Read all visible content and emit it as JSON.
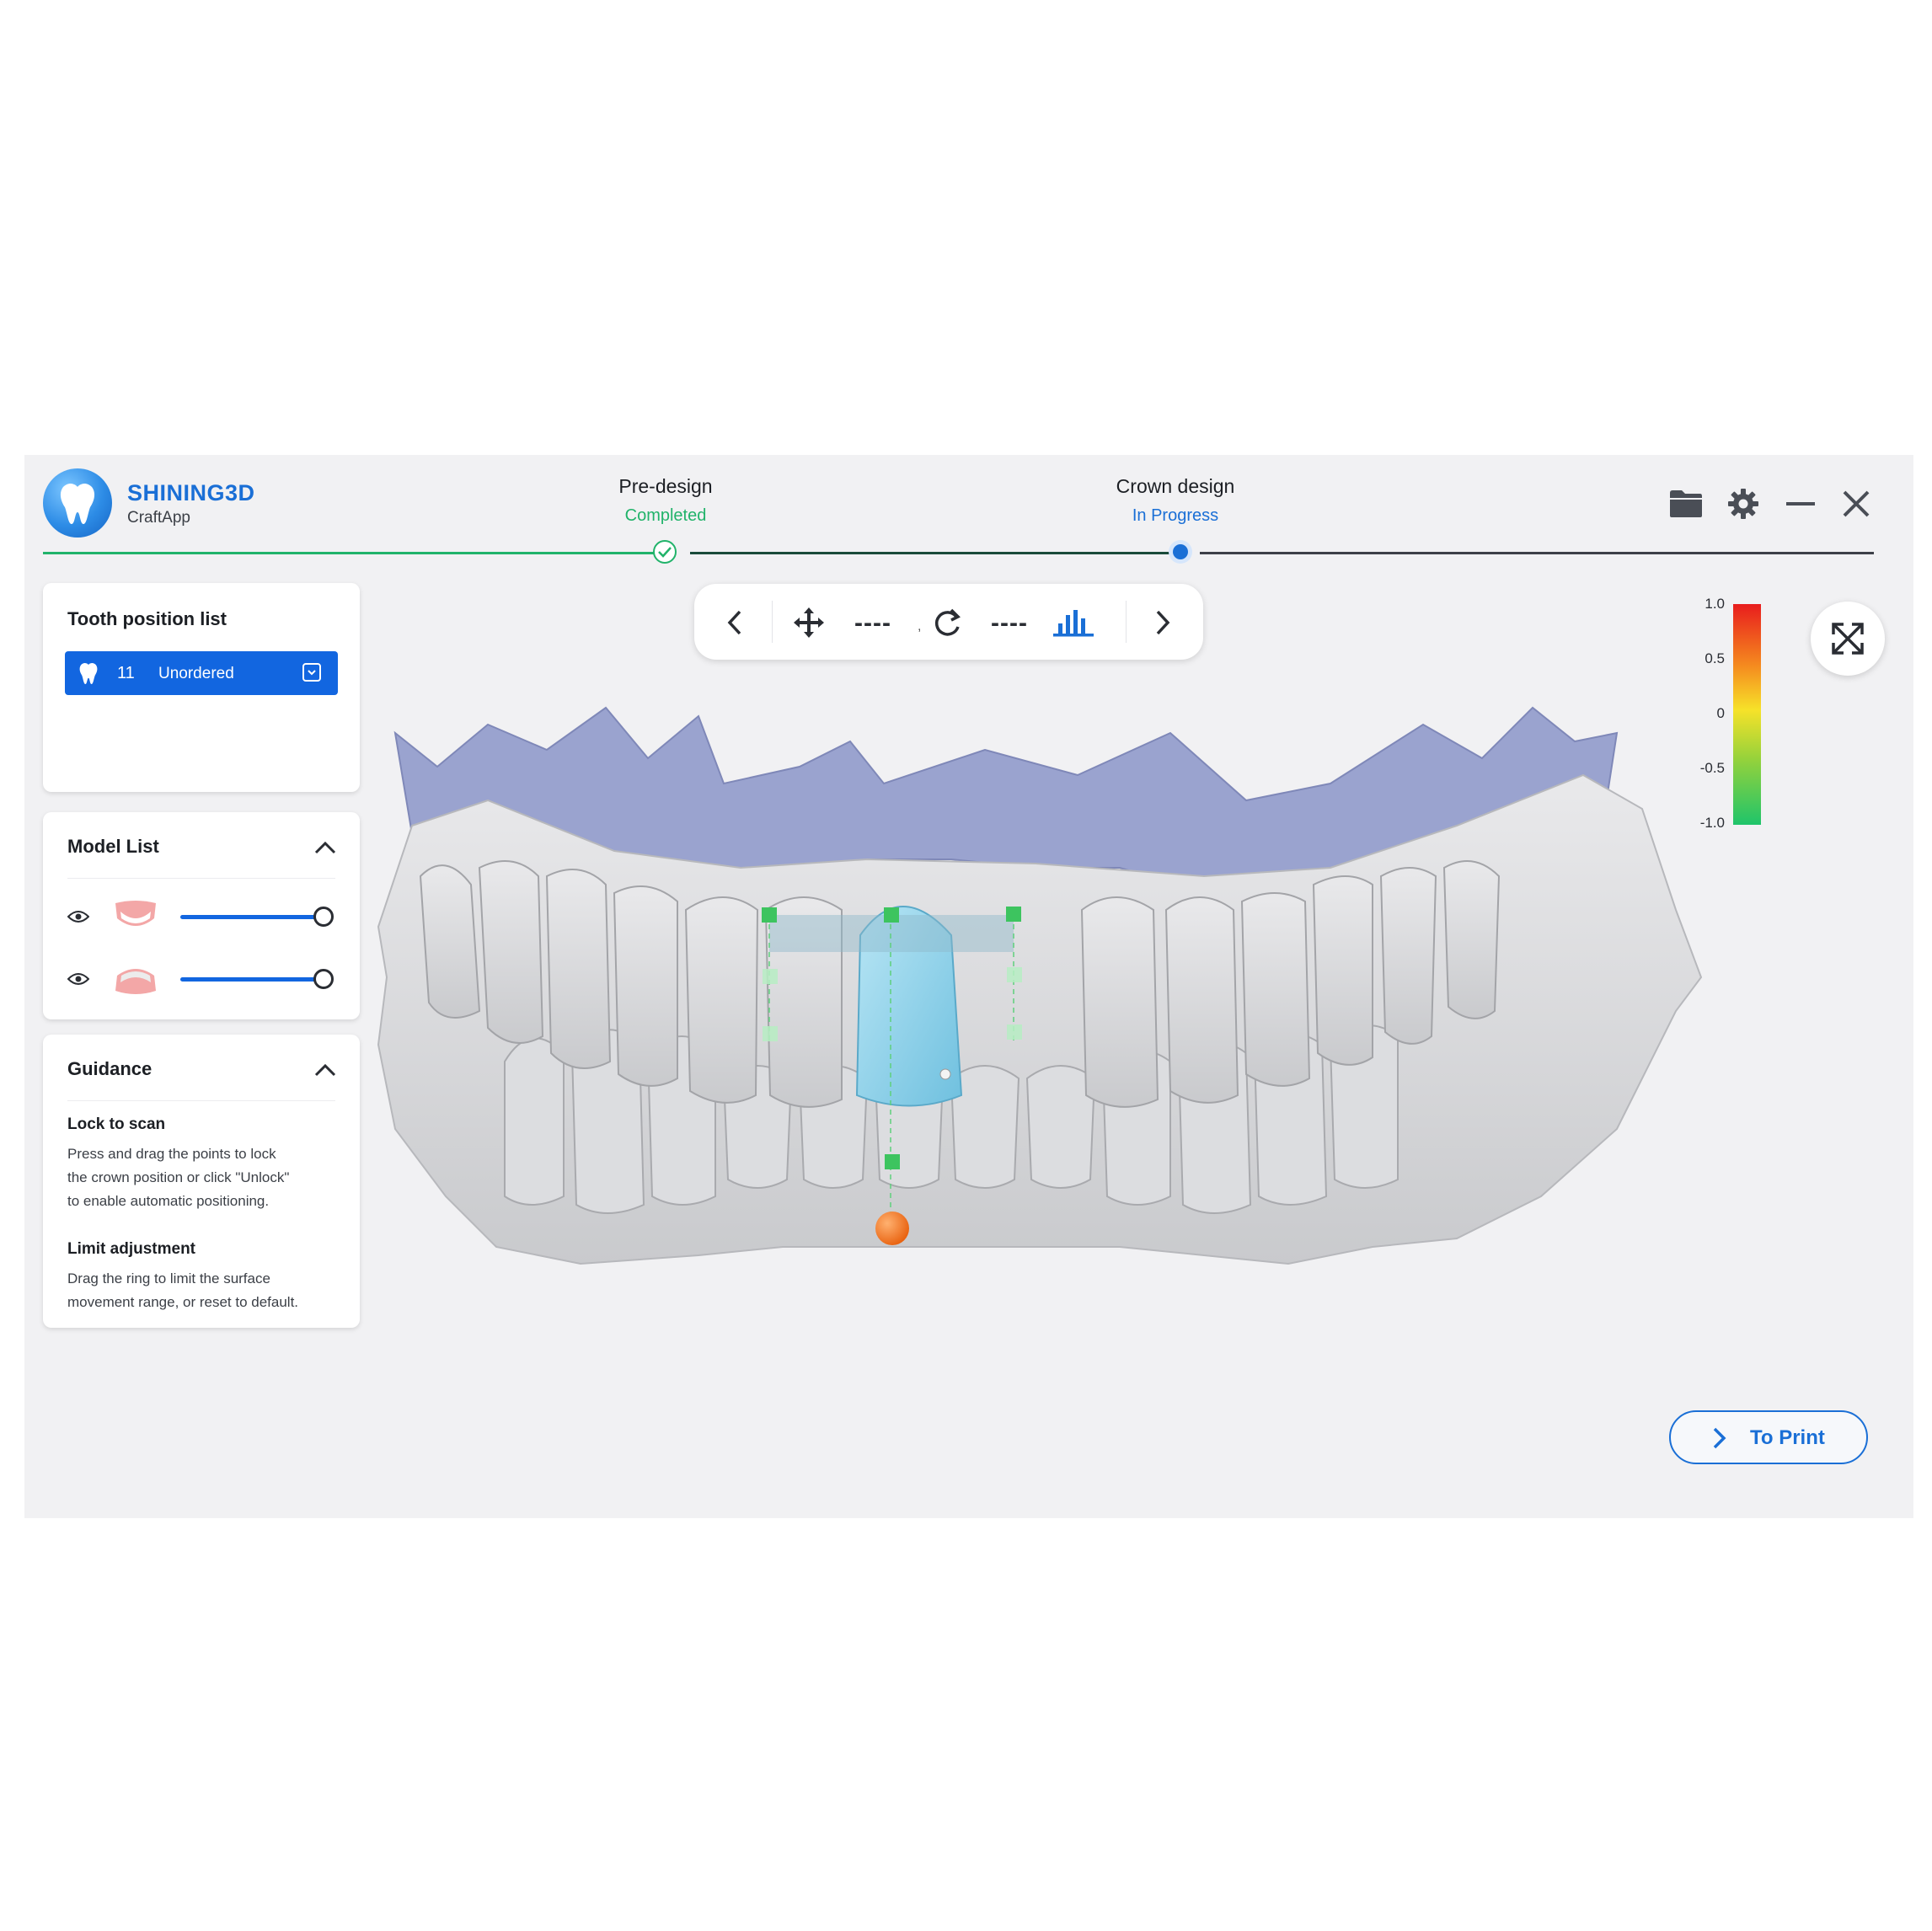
{
  "brand": {
    "name": "SHINING3D",
    "product": "CraftApp"
  },
  "steps": [
    {
      "title": "Pre-design",
      "status": "Completed"
    },
    {
      "title": "Crown design",
      "status": "In Progress"
    }
  ],
  "tooth_panel": {
    "title": "Tooth position list",
    "item": {
      "number": "11",
      "label": "Unordered"
    }
  },
  "model_panel": {
    "title": "Model List",
    "models": [
      {
        "icon": "upper-jaw-icon",
        "opacity": 1.0
      },
      {
        "icon": "lower-jaw-icon",
        "opacity": 1.0
      }
    ]
  },
  "guidance": {
    "title": "Guidance",
    "sections": [
      {
        "heading": "Lock to scan",
        "lines": [
          "Press and drag the points to lock",
          "the crown position or click \"Unlock\"",
          "to enable automatic positioning."
        ]
      },
      {
        "heading": "Limit adjustment",
        "lines": [
          "Drag the ring to limit the surface",
          "movement range, or reset to default."
        ]
      }
    ]
  },
  "toolbar": {
    "dash1": "----",
    "comma": ",",
    "dash2": "----"
  },
  "color_scale": {
    "labels": [
      "1.0",
      "0.5",
      "0",
      "-0.5",
      "-1.0"
    ]
  },
  "actions": {
    "print_label": "To Print"
  },
  "colors": {
    "accent": "#1a6fd6",
    "success": "#21b36a",
    "crown": "#8fd2ea",
    "gingiva": "#9aa3cf"
  }
}
